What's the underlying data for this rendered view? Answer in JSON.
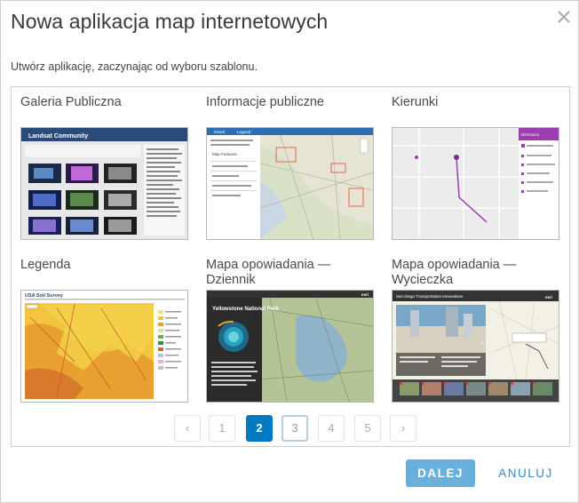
{
  "dialog": {
    "title": "Nowa aplikacja map internetowych",
    "subtitle": "Utwórz aplikację, zaczynając od wyboru szablonu."
  },
  "templates": [
    {
      "label": "Galeria Publiczna",
      "thumb_title": "Landsat Community"
    },
    {
      "label": "Informacje publiczne",
      "thumb_tabs": [
        "Mixed",
        "Legend"
      ],
      "thumb_subtitle": "Map Features"
    },
    {
      "label": "Kierunki",
      "thumb_panel_title": "Directions"
    },
    {
      "label": "Legenda",
      "thumb_title": "USA Soil Survey"
    },
    {
      "label": "Mapa opowiadania — Dziennik",
      "thumb_title": "Yellowstone National Park",
      "thumb_logo": "esri"
    },
    {
      "label": "Mapa opowiadania — Wycieczka",
      "thumb_title": "San Diego Transportation Innovations",
      "thumb_logo": "esri"
    }
  ],
  "pagination": {
    "prev": "‹",
    "pages": [
      "1",
      "2",
      "3",
      "4",
      "5"
    ],
    "current": "2",
    "next": "›"
  },
  "buttons": {
    "next_label": "DALEJ",
    "cancel_label": "ANULUJ"
  },
  "colors": {
    "accent": "#0079c1",
    "button_primary": "#6ab0dd",
    "link": "#2f8ccf"
  },
  "icons": {
    "close": "close-icon",
    "prev": "chevron-left-icon",
    "next": "chevron-right-icon"
  }
}
